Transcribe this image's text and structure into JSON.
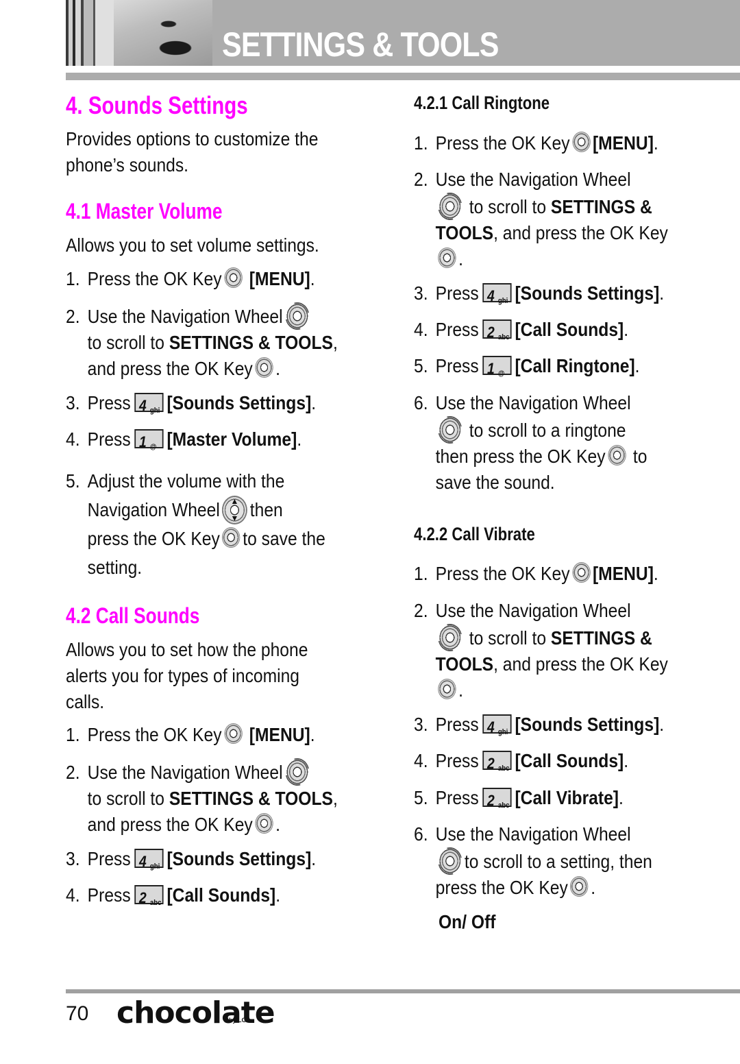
{
  "header": {
    "title": "SETTINGS & TOOLS"
  },
  "left": {
    "section_title": "4. Sounds Settings",
    "intro": [
      "Provides options to customize the",
      "phone’s sounds."
    ],
    "master_volume": {
      "title": "4.1 Master Volume",
      "desc": "Allows you to set volume settings.",
      "steps": {
        "s1": {
          "num": "1.",
          "pre": "Press the OK Key",
          "bold": "[MENU]",
          "post": "."
        },
        "s2": {
          "num": "2.",
          "l1": "Use the Navigation Wheel",
          "l2_pre": "to scroll to ",
          "l2_bold": "SETTINGS & TOOLS",
          "l2_post": ",",
          "l3": "and press the OK Key",
          "l3_post": "."
        },
        "s3": {
          "num": "3.",
          "pre": "Press",
          "key_digit": "4",
          "key_letters": "ghi",
          "bold": "[Sounds Settings]",
          "post": "."
        },
        "s4": {
          "num": "4.",
          "pre": "Press",
          "key_digit": "1",
          "key_letters": "@",
          "bold": "[Master Volume]",
          "post": "."
        },
        "s5": {
          "num": "5.",
          "l1": "Adjust the volume with the",
          "l2_pre": "Navigation Wheel",
          "l2_post": "then",
          "l3_pre": "press the OK Key",
          "l3_post": "to save the",
          "l4": "setting."
        }
      }
    },
    "call_sounds": {
      "title": "4.2 Call Sounds",
      "desc": [
        "Allows you to set how the phone",
        "alerts you for types of incoming",
        "calls."
      ],
      "steps": {
        "s1": {
          "num": "1.",
          "pre": "Press the OK Key",
          "bold": "[MENU]",
          "post": "."
        },
        "s2": {
          "num": "2.",
          "l1": "Use the Navigation Wheel",
          "l2_pre": "to scroll to ",
          "l2_bold": "SETTINGS & TOOLS",
          "l2_post": ",",
          "l3": "and press the OK Key",
          "l3_post": "."
        },
        "s3": {
          "num": "3.",
          "pre": "Press",
          "key_digit": "4",
          "key_letters": "ghi",
          "bold": "[Sounds Settings]",
          "post": "."
        },
        "s4": {
          "num": "4.",
          "pre": "Press",
          "key_digit": "2",
          "key_letters": "abc",
          "bold": "[Call Sounds]",
          "post": "."
        }
      }
    }
  },
  "right": {
    "ringtone": {
      "title": "4.2.1 Call Ringtone",
      "steps": {
        "s1": {
          "num": "1.",
          "pre": "Press the OK Key",
          "bold": "[MENU]",
          "post": "."
        },
        "s2": {
          "num": "2.",
          "l1": "Use the Navigation Wheel",
          "l2_pre": "to scroll to ",
          "l2_bold": "SETTINGS &",
          "l3_bold": "TOOLS",
          "l3_post": ", and press the OK Key",
          "l4_post": "."
        },
        "s3": {
          "num": "3.",
          "pre": "Press",
          "key_digit": "4",
          "key_letters": "ghi",
          "bold": "[Sounds Settings]",
          "post": "."
        },
        "s4": {
          "num": "4.",
          "pre": "Press",
          "key_digit": "2",
          "key_letters": "abc",
          "bold": "[Call Sounds]",
          "post": "."
        },
        "s5": {
          "num": "5.",
          "pre": "Press",
          "key_digit": "1",
          "key_letters": "@",
          "bold": "[Call Ringtone]",
          "post": "."
        },
        "s6": {
          "num": "6.",
          "l1": "Use the Navigation Wheel",
          "l2": "to scroll to a ringtone",
          "l3_pre": "then press the OK Key",
          "l3_post": "to",
          "l4": "save the sound."
        }
      }
    },
    "vibrate": {
      "title": "4.2.2 Call Vibrate",
      "steps": {
        "s1": {
          "num": "1.",
          "pre": "Press the OK Key",
          "bold": "[MENU]",
          "post": "."
        },
        "s2": {
          "num": "2.",
          "l1": "Use the Navigation Wheel",
          "l2_pre": "to scroll to ",
          "l2_bold": "SETTINGS &",
          "l3_bold": "TOOLS",
          "l3_post": ", and press the OK Key",
          "l4_post": "."
        },
        "s3": {
          "num": "3.",
          "pre": "Press",
          "key_digit": "4",
          "key_letters": "ghi",
          "bold": "[Sounds Settings]",
          "post": "."
        },
        "s4": {
          "num": "4.",
          "pre": "Press",
          "key_digit": "2",
          "key_letters": "abc",
          "bold": "[Call Sounds]",
          "post": "."
        },
        "s5": {
          "num": "5.",
          "pre": "Press",
          "key_digit": "2",
          "key_letters": "abc",
          "bold": "[Call Vibrate]",
          "post": "."
        },
        "s6": {
          "num": "6.",
          "l1": "Use the Navigation Wheel",
          "l2": "to scroll to a setting, then",
          "l3_pre": "press the OK Key",
          "l3_post": "."
        }
      },
      "options": "On/ Off"
    }
  },
  "footer": {
    "page_number": "70",
    "brand": "chocolate",
    "brand_tm": "™",
    "brand_by": "by LG"
  },
  "colors": {
    "accent": "#ff00ff",
    "header_gray": "#acacac"
  }
}
